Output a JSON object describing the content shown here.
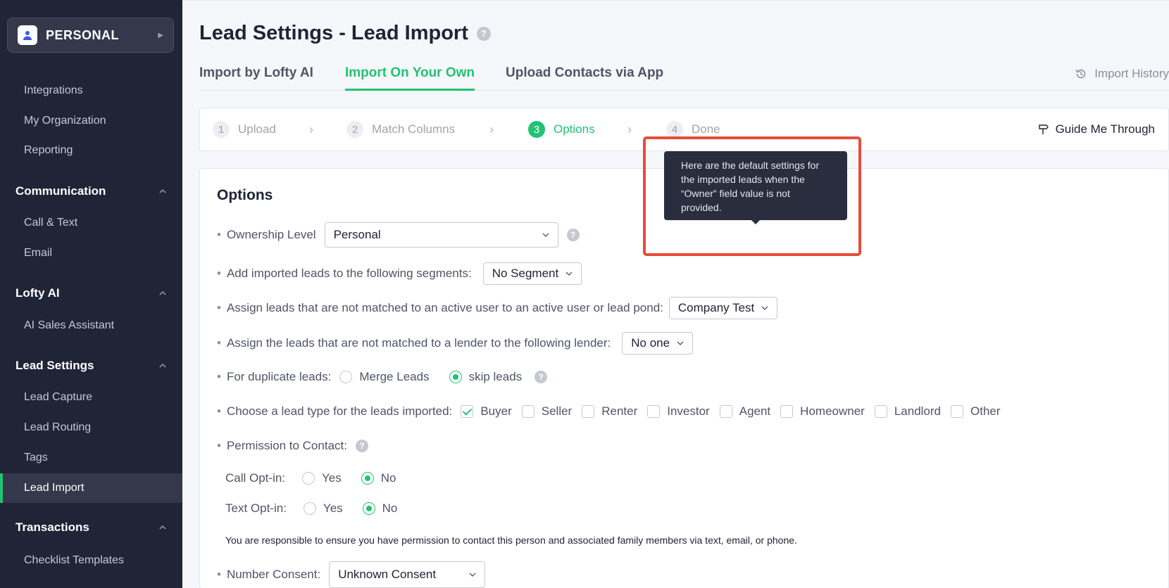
{
  "sidebar": {
    "workspace_label": "PERSONAL",
    "top_items": [
      "Integrations",
      "My Organization",
      "Reporting"
    ],
    "sections": [
      {
        "title": "Communication",
        "items": [
          "Call & Text",
          "Email"
        ]
      },
      {
        "title": "Lofty AI",
        "items": [
          "AI Sales Assistant"
        ]
      },
      {
        "title": "Lead Settings",
        "items": [
          "Lead Capture",
          "Lead Routing",
          "Tags",
          "Lead Import"
        ]
      },
      {
        "title": "Transactions",
        "items": [
          "Checklist Templates"
        ]
      }
    ],
    "active_item": "Lead Import"
  },
  "header": {
    "title": "Lead Settings - Lead Import",
    "help": "?"
  },
  "tabs": [
    "Import by Lofty AI",
    "Import On Your Own",
    "Upload Contacts via App"
  ],
  "active_tab": "Import On Your Own",
  "import_history": "Import History",
  "steps": {
    "items": [
      {
        "num": "1",
        "label": "Upload"
      },
      {
        "num": "2",
        "label": "Match Columns"
      },
      {
        "num": "3",
        "label": "Options"
      },
      {
        "num": "4",
        "label": "Done"
      }
    ],
    "active": "Options",
    "guide": "Guide Me Through"
  },
  "options": {
    "title": "Options",
    "ownership_label": "Ownership Level",
    "ownership_value": "Personal",
    "segments_label": "Add imported leads to the following segments:",
    "segments_value": "No Segment",
    "assign_user_label": "Assign leads that are not matched to an active user to an active user or lead pond:",
    "assign_user_value": "Company Test",
    "assign_lender_label": "Assign the leads that are not matched to a lender to the following lender:",
    "assign_lender_value": "No one",
    "duplicate_label": "For duplicate leads:",
    "duplicate_options": [
      "Merge Leads",
      "skip leads"
    ],
    "duplicate_selected": "skip leads",
    "lead_type_label": "Choose a lead type for the leads imported:",
    "lead_types": [
      "Buyer",
      "Seller",
      "Renter",
      "Investor",
      "Agent",
      "Homeowner",
      "Landlord",
      "Other"
    ],
    "lead_types_checked": [
      "Buyer"
    ],
    "permission_label": "Permission to Contact:",
    "call_optin_label": "Call Opt-in:",
    "text_optin_label": "Text Opt-in:",
    "yes": "Yes",
    "no": "No",
    "call_optin_selected": "No",
    "text_optin_selected": "No",
    "note": "You are responsible to ensure you have permission to contact this person and associated family members via text, email, or phone.",
    "number_consent_label": "Number Consent:",
    "number_consent_value": "Unknown Consent"
  },
  "tooltip": {
    "text": "Here are the default settings for the imported leads when the “Owner” field value is not provided."
  },
  "colors": {
    "sidebar_bg": "#202437",
    "accent": "#20c472",
    "highlight": "#e94b3c"
  }
}
